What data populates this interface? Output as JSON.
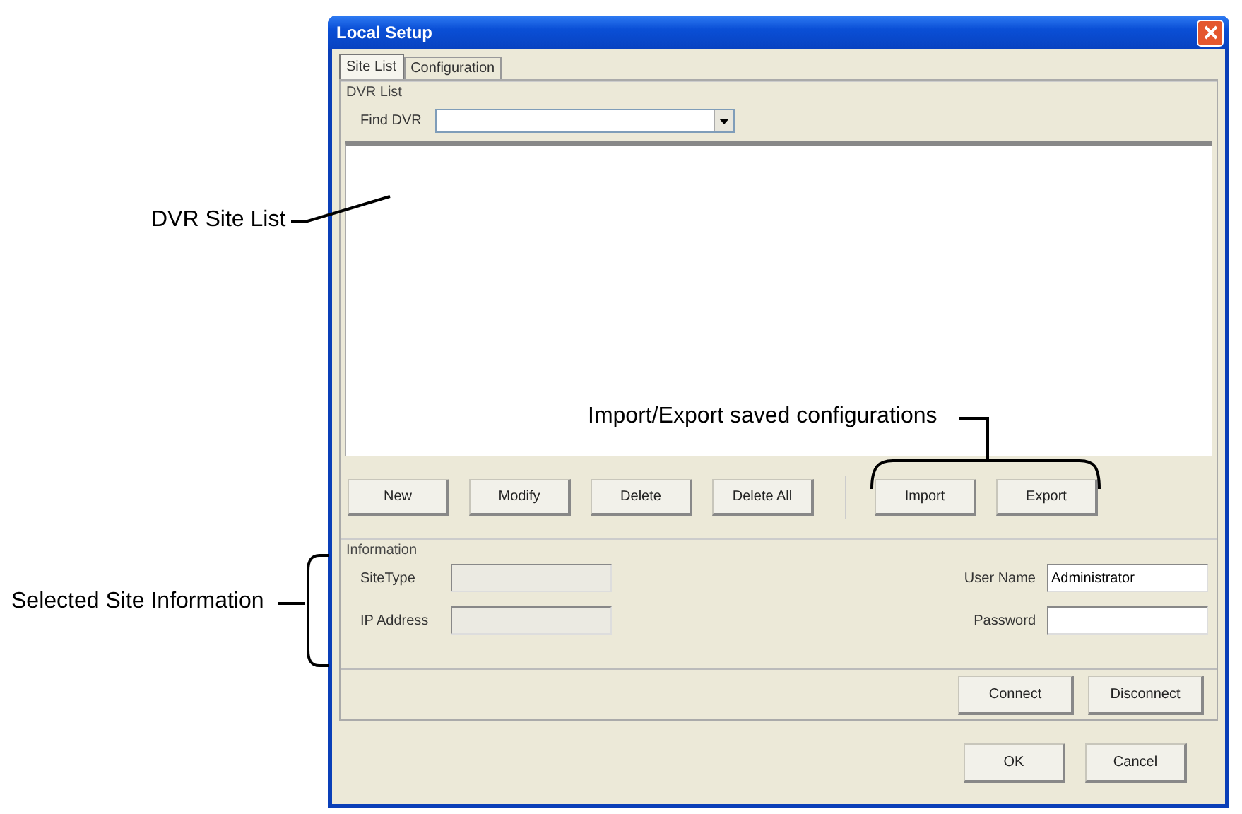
{
  "window": {
    "title": "Local Setup"
  },
  "tabs": [
    {
      "label": "Site List",
      "selected": true
    },
    {
      "label": "Configuration",
      "selected": false
    }
  ],
  "dvr_list": {
    "legend": "DVR List",
    "find_label": "Find DVR"
  },
  "site_buttons": [
    "New",
    "Modify",
    "Delete",
    "Delete All"
  ],
  "io_buttons": [
    "Import",
    "Export"
  ],
  "information": {
    "legend": "Information",
    "fields": [
      {
        "label": "SiteType",
        "disabled": true
      },
      {
        "label": "User Name",
        "value": "Administrator",
        "disabled": false
      },
      {
        "label": "IP Address",
        "disabled": true
      },
      {
        "label": "Password",
        "disabled": false
      }
    ]
  },
  "connect_buttons": [
    "Connect",
    "Disconnect"
  ],
  "dialog_buttons": [
    "OK",
    "Cancel"
  ],
  "annotations": {
    "site_list": "DVR Site List",
    "import_export": "Import/Export saved configurations",
    "site_info": "Selected Site Information"
  }
}
